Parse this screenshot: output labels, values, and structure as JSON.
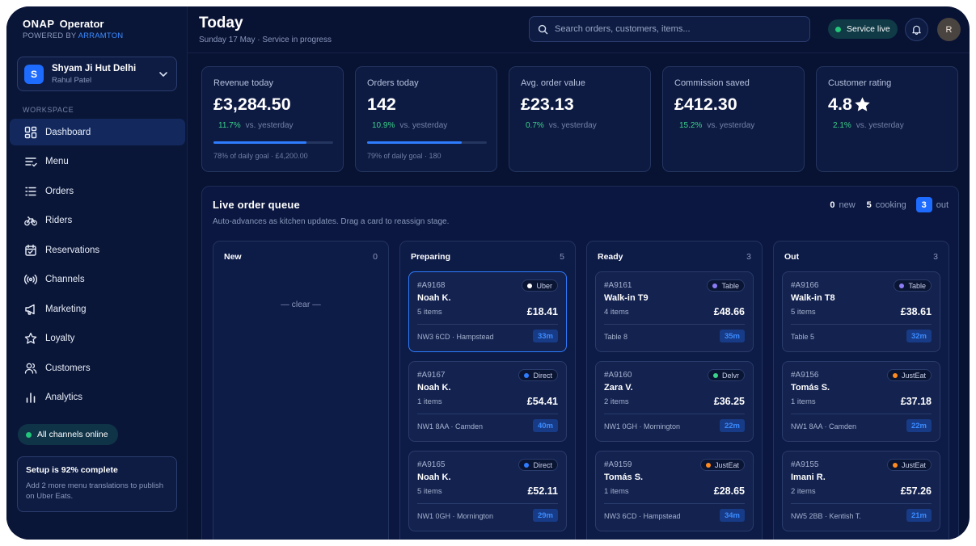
{
  "brand": {
    "logo": "ONAP",
    "name": "Operator",
    "powered_prefix": "POWERED BY",
    "powered_by": "ARRAMTON"
  },
  "store": {
    "initial": "S",
    "name": "Shyam Ji Hut Delhi",
    "user": "Rahul Patel"
  },
  "sidebar": {
    "section_label": "WORKSPACE",
    "items": [
      {
        "label": "Dashboard",
        "icon": "dashboard-icon",
        "active": true
      },
      {
        "label": "Menu",
        "icon": "menu-icon"
      },
      {
        "label": "Orders",
        "icon": "orders-icon"
      },
      {
        "label": "Riders",
        "icon": "bike-icon"
      },
      {
        "label": "Reservations",
        "icon": "calendar-icon"
      },
      {
        "label": "Channels",
        "icon": "broadcast-icon"
      },
      {
        "label": "Marketing",
        "icon": "megaphone-icon"
      },
      {
        "label": "Loyalty",
        "icon": "star-icon"
      },
      {
        "label": "Customers",
        "icon": "users-icon"
      },
      {
        "label": "Analytics",
        "icon": "bar-chart-icon"
      }
    ],
    "status": "All channels online",
    "setup": {
      "title": "Setup is 92% complete",
      "text": "Add 2 more menu translations to publish on Uber Eats."
    }
  },
  "header": {
    "title": "Today",
    "subtitle": "Sunday 17 May · Service in progress",
    "search_placeholder": "Search orders, customers, items...",
    "service_status": "Service live",
    "avatar_initial": "R"
  },
  "stats": [
    {
      "label": "Revenue today",
      "value": "£3,284.50",
      "change": "11.7%",
      "vs": "vs. yesterday",
      "progress": 0.78,
      "foot": "78% of daily goal · £4,200.00"
    },
    {
      "label": "Orders today",
      "value": "142",
      "change": "10.9%",
      "vs": "vs. yesterday",
      "progress": 0.79,
      "foot": "79% of daily goal · 180"
    },
    {
      "label": "Avg. order value",
      "value": "£23.13",
      "change": "0.7%",
      "vs": "vs. yesterday"
    },
    {
      "label": "Commission saved",
      "value": "£412.30",
      "change": "15.2%",
      "vs": "vs. yesterday"
    },
    {
      "label": "Customer rating",
      "value": "4.8",
      "change": "2.1%",
      "vs": "vs. yesterday",
      "star": true
    }
  ],
  "queue": {
    "title": "Live order queue",
    "subtitle": "Auto-advances as kitchen updates. Drag a card to reassign stage.",
    "counts": {
      "new": "0",
      "new_label": "new",
      "cooking": "5",
      "cooking_label": "cooking",
      "out": "3",
      "out_label": "out"
    },
    "empty_text": "— clear —",
    "columns": [
      {
        "title": "New",
        "count": "0",
        "cards": []
      },
      {
        "title": "Preparing",
        "count": "5",
        "cards": [
          {
            "id": "#A9168",
            "name": "Noah K.",
            "items": "5 items",
            "price": "£18.41",
            "loc": "NW3 6CD · Hampstead",
            "time": "33m",
            "channel": "Uber",
            "channel_color": "#ffffff",
            "selected": true
          },
          {
            "id": "#A9167",
            "name": "Noah K.",
            "items": "1 items",
            "price": "£54.41",
            "loc": "NW1 8AA · Camden",
            "time": "40m",
            "channel": "Direct",
            "channel_color": "#2f7dff"
          },
          {
            "id": "#A9165",
            "name": "Noah K.",
            "items": "5 items",
            "price": "£52.11",
            "loc": "NW1 0GH · Mornington",
            "time": "29m",
            "channel": "Direct",
            "channel_color": "#2f7dff"
          }
        ]
      },
      {
        "title": "Ready",
        "count": "3",
        "cards": [
          {
            "id": "#A9161",
            "name": "Walk-in T9",
            "items": "4 items",
            "price": "£48.66",
            "loc": "Table 8",
            "time": "35m",
            "channel": "Table",
            "channel_color": "#8b7cf6"
          },
          {
            "id": "#A9160",
            "name": "Zara V.",
            "items": "2 items",
            "price": "£36.25",
            "loc": "NW1 0GH · Mornington",
            "time": "22m",
            "channel": "Delvr",
            "channel_color": "#3ad38a"
          },
          {
            "id": "#A9159",
            "name": "Tomás S.",
            "items": "1 items",
            "price": "£28.65",
            "loc": "NW3 6CD · Hampstead",
            "time": "34m",
            "channel": "JustEat",
            "channel_color": "#ff8a1f"
          }
        ]
      },
      {
        "title": "Out",
        "count": "3",
        "cards": [
          {
            "id": "#A9166",
            "name": "Walk-in T8",
            "items": "5 items",
            "price": "£38.61",
            "loc": "Table 5",
            "time": "32m",
            "channel": "Table",
            "channel_color": "#8b7cf6"
          },
          {
            "id": "#A9156",
            "name": "Tomás S.",
            "items": "1 items",
            "price": "£37.18",
            "loc": "NW1 8AA · Camden",
            "time": "22m",
            "channel": "JustEat",
            "channel_color": "#ff8a1f"
          },
          {
            "id": "#A9155",
            "name": "Imani R.",
            "items": "2 items",
            "price": "£57.26",
            "loc": "NW5 2BB · Kentish T.",
            "time": "21m",
            "channel": "JustEat",
            "channel_color": "#ff8a1f"
          }
        ]
      }
    ]
  },
  "colors": {
    "accent": "#1e6bff",
    "positive": "#3ad38a",
    "status_online": "#22c57a"
  }
}
